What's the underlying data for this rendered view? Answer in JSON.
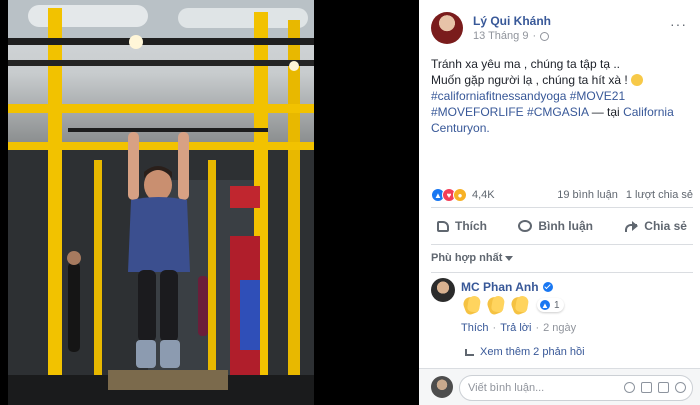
{
  "post": {
    "author": "Lý Qui Khánh",
    "date": "13 Tháng 9",
    "more": "···",
    "text_lines": [
      "Tránh xa yêu ma , chúng ta tập tạ ..",
      "Muốn gặp người lạ , chúng ta hít xà !"
    ],
    "hashtags_1": "#californiafitnessandyoga #MOVE21",
    "hashtags_2": "#MOVEFORLIFE #CMGASIA",
    "location_prefix": " — tại ",
    "location": "California Centuryon."
  },
  "stats": {
    "reaction_count": "4,4K",
    "comments": "19 bình luận",
    "shares": "1 lượt chia sẻ"
  },
  "actions": {
    "like": "Thích",
    "comment": "Bình luận",
    "share": "Chia sẻ"
  },
  "sort": {
    "label": "Phù hợp nhất"
  },
  "comment": {
    "author": "MC Phan Anh",
    "react_count": "1",
    "like": "Thích",
    "reply": "Trả lời",
    "time": "2 ngày",
    "view_more": "Xem thêm 2 phản hồi"
  },
  "composer": {
    "placeholder": "Viết bình luận..."
  },
  "colors": {
    "link": "#385898",
    "facebook_blue": "#1877f2",
    "gym_yellow": "#f2c200"
  }
}
